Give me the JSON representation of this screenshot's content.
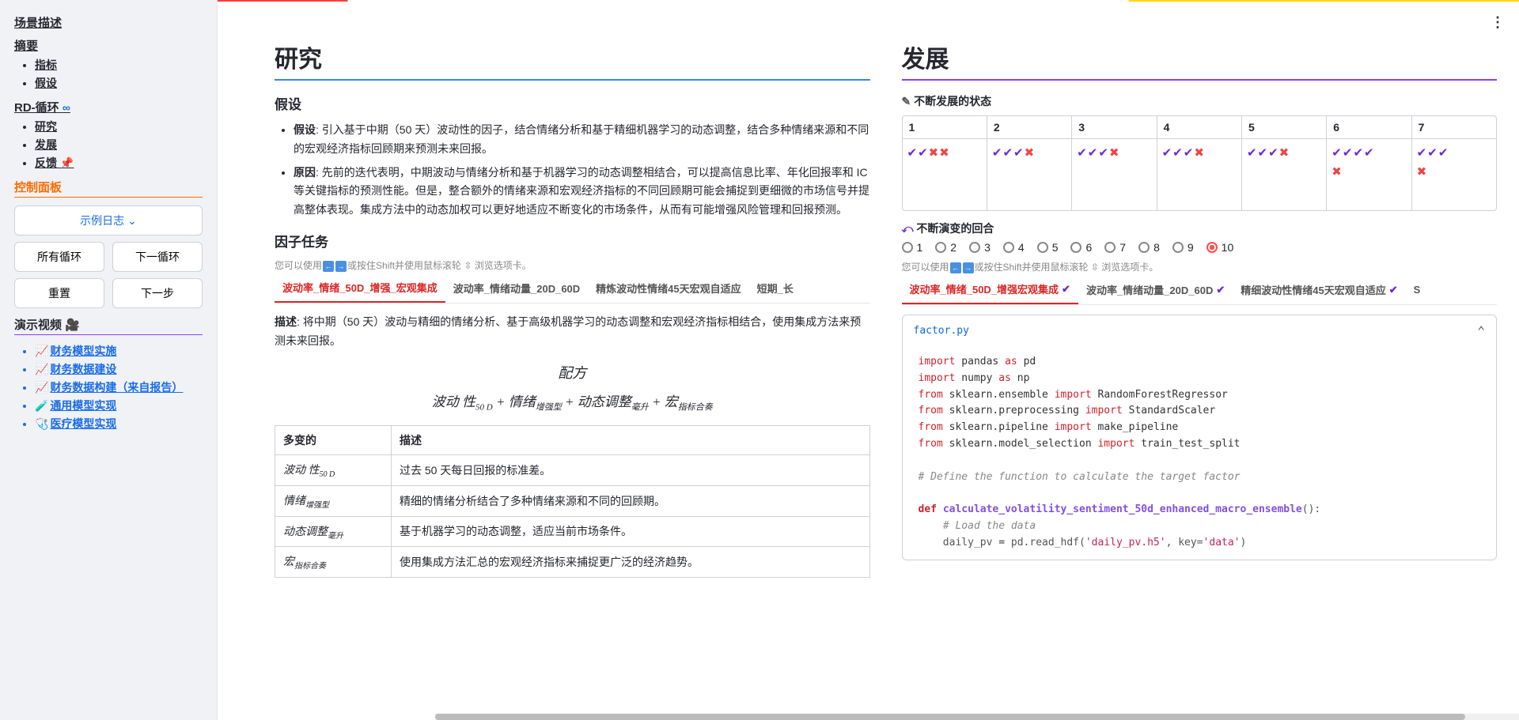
{
  "sidebar": {
    "scene_desc": "场景描述",
    "abstract": "摘要",
    "abstract_items": [
      "指标",
      "假设"
    ],
    "rd_loop": "RD-循环",
    "rd_items": [
      "研究",
      "发展",
      "反馈"
    ],
    "control_panel": "控制面板",
    "example_btn": "示例日志",
    "all_loop": "所有循环",
    "next_loop": "下一循环",
    "reset": "重置",
    "next_step": "下一步",
    "demo_video": "演示视频",
    "links": [
      "财务模型实施",
      "财务数据建设",
      "财务数据构建（来自报告）",
      "通用模型实现",
      "医疗模型实现"
    ]
  },
  "research": {
    "title": "研究",
    "hypothesis_h": "假设",
    "hyp_label": "假设",
    "hyp_text": ": 引入基于中期（50 天）波动性的因子，结合情绪分析和基于精细机器学习的动态调整，结合多种情绪来源和不同的宏观经济指标回顾期来预测未来回报。",
    "reason_label": "原因",
    "reason_text": ": 先前的迭代表明，中期波动与情绪分析和基于机器学习的动态调整相结合，可以提高信息比率、年化回报率和 IC 等关键指标的预测性能。但是，整合额外的情绪来源和宏观经济指标的不同回顾期可能会捕捉到更细微的市场信号并提高整体表现。集成方法中的动态加权可以更好地适应不断变化的市场条件，从而有可能增强风险管理和回报预测。",
    "factor_task_h": "因子任务",
    "tab_hint": "您可以使用 ↔ 或按住Shift并使用鼠标滚轮 ⇅ 浏览选项卡。",
    "tabs": [
      "波动率_情绪_50D_增强_宏观集成",
      "波动率_情绪动量_20D_60D",
      "精炼波动性情绪45天宏观自适应",
      "短期_长"
    ],
    "desc_label": "描述",
    "desc_text": ": 将中期（50 天）波动与精细的情绪分析、基于高级机器学习的动态调整和宏观经济指标相结合，使用集成方法来预测未来回报。",
    "formula_h": "配方",
    "formula_parts": {
      "p1": "波动 性",
      "s1": "50 D",
      "p2": " + 情绪",
      "s2": "增强型",
      "p3": " + 动态调整",
      "s3": "毫升",
      "p4": " + 宏",
      "s4": "指标合奏"
    },
    "table": {
      "h1": "多变的",
      "h2": "描述",
      "rows": [
        {
          "v": "波动 性",
          "sub": "50 D",
          "d": "过去 50 天每日回报的标准差。"
        },
        {
          "v": "情绪",
          "sub": "增强型",
          "d": "精细的情绪分析结合了多种情绪来源和不同的回顾期。"
        },
        {
          "v": "动态调整",
          "sub": "毫升",
          "d": "基于机器学习的动态调整，适应当前市场条件。"
        },
        {
          "v": "宏",
          "sub": "指标合奏",
          "d": "使用集成方法汇总的宏观经济指标来捕捉更广泛的经济趋势。"
        }
      ]
    }
  },
  "develop": {
    "title": "发展",
    "evolving_state": "不断发展的状态",
    "states": [
      {
        "n": "1",
        "r1": "ccxx",
        "r2": ""
      },
      {
        "n": "2",
        "r1": "cccx",
        "r2": ""
      },
      {
        "n": "3",
        "r1": "cccx",
        "r2": ""
      },
      {
        "n": "4",
        "r1": "cccx",
        "r2": ""
      },
      {
        "n": "5",
        "r1": "cccx",
        "r2": ""
      },
      {
        "n": "6",
        "r1": "cccc",
        "r2": "x"
      },
      {
        "n": "7",
        "r1": "ccc",
        "r2": "x"
      }
    ],
    "evolving_rounds": "不断演变的回合",
    "rounds": [
      "1",
      "2",
      "3",
      "4",
      "5",
      "6",
      "7",
      "8",
      "9",
      "10"
    ],
    "selected_round": "10",
    "tab_hint": "您可以使用 ↔ 或按住Shift并使用鼠标滚轮 ⇅ 浏览选项卡。",
    "dtabs": [
      "波动率_情绪_50D_增强宏观集成",
      "波动率_情绪动量_20D_60D",
      "精细波动性情绪45天宏观自适应",
      "S"
    ],
    "file": "factor.py",
    "code_lines": [
      {
        "t": "import",
        "parts": [
          "import",
          " pandas ",
          "as",
          " pd"
        ]
      },
      {
        "t": "import",
        "parts": [
          "import",
          " numpy ",
          "as",
          " np"
        ]
      },
      {
        "t": "from",
        "parts": [
          "from",
          " sklearn.ensemble ",
          "import",
          " RandomForestRegressor"
        ]
      },
      {
        "t": "from",
        "parts": [
          "from",
          " sklearn.preprocessing ",
          "import",
          " StandardScaler"
        ]
      },
      {
        "t": "from",
        "parts": [
          "from",
          " sklearn.pipeline ",
          "import",
          " make_pipeline"
        ]
      },
      {
        "t": "from",
        "parts": [
          "from",
          " sklearn.model_selection ",
          "import",
          " train_test_split"
        ]
      },
      {
        "t": "blank"
      },
      {
        "t": "comment",
        "text": "# Define the function to calculate the target factor"
      },
      {
        "t": "blank"
      },
      {
        "t": "def",
        "name": "calculate_volatility_sentiment_50d_enhanced_macro_ensemble"
      },
      {
        "t": "comment_indent",
        "text": "# Load the data"
      },
      {
        "t": "assign",
        "lhs": "daily_pv",
        "rhs_pre": "pd.read_hdf(",
        "s1": "'daily_pv.h5'",
        "mid": ", key=",
        "s2": "'data'",
        "post": ")"
      }
    ]
  }
}
